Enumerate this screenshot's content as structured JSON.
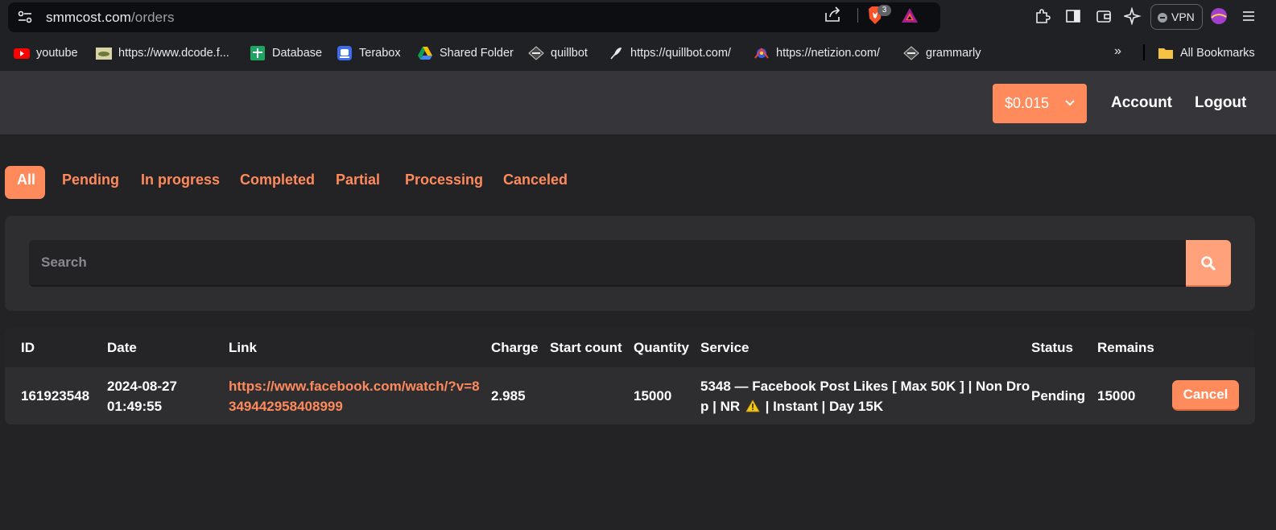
{
  "browser": {
    "url_domain": "smmcost.com",
    "url_path": "/orders",
    "brave_badge_count": "3",
    "vpn_label": "VPN",
    "bookmarks": [
      {
        "label": "youtube",
        "icon": "youtube-icon"
      },
      {
        "label": "https://www.dcode.f...",
        "icon": "dcode-favicon"
      },
      {
        "label": "Database",
        "icon": "sheets-icon"
      },
      {
        "label": "Terabox",
        "icon": "terabox-icon"
      },
      {
        "label": "Shared Folder",
        "icon": "google-drive-icon"
      },
      {
        "label": "quillbot",
        "icon": "quillbot-favicon"
      },
      {
        "label": "https://quillbot.com/",
        "icon": "feather-icon"
      },
      {
        "label": "https://netizion.com/",
        "icon": "netizion-favicon"
      },
      {
        "label": "grammarly",
        "icon": "grammarly-favicon"
      }
    ],
    "more_bookmarks": "»",
    "all_bookmarks_label": "All Bookmarks"
  },
  "header": {
    "balance": "$0.015",
    "account_label": "Account",
    "logout_label": "Logout"
  },
  "tabs": [
    {
      "label": "All",
      "active": true
    },
    {
      "label": "Pending"
    },
    {
      "label": "In progress"
    },
    {
      "label": "Completed"
    },
    {
      "label": "Partial"
    },
    {
      "label": "Processing"
    },
    {
      "label": "Canceled"
    }
  ],
  "search": {
    "placeholder": "Search",
    "value": ""
  },
  "table": {
    "columns": [
      "ID",
      "Date",
      "Link",
      "Charge",
      "Start count",
      "Quantity",
      "Service",
      "Status",
      "Remains"
    ],
    "rows": [
      {
        "id": "161923548",
        "date_line1": "2024-08-27",
        "date_line2": "01:49:55",
        "link_line1": "https://www.facebook.com/watch/?v=8",
        "link_line2": "349442958408999",
        "charge": "2.985",
        "start_count": "",
        "quantity": "15000",
        "service_line1": "5348 — Facebook Post Likes [ Max 50K ] | Non Dro",
        "service_line2a": "p | NR",
        "service_line2b": "| Instant | Day 15K",
        "status": "Pending",
        "remains": "15000",
        "action_label": "Cancel"
      }
    ]
  },
  "colors": {
    "accent": "#ff8a5c",
    "background": "#232325",
    "header_bg": "#36363a",
    "panel_bg": "#2e2e31"
  }
}
